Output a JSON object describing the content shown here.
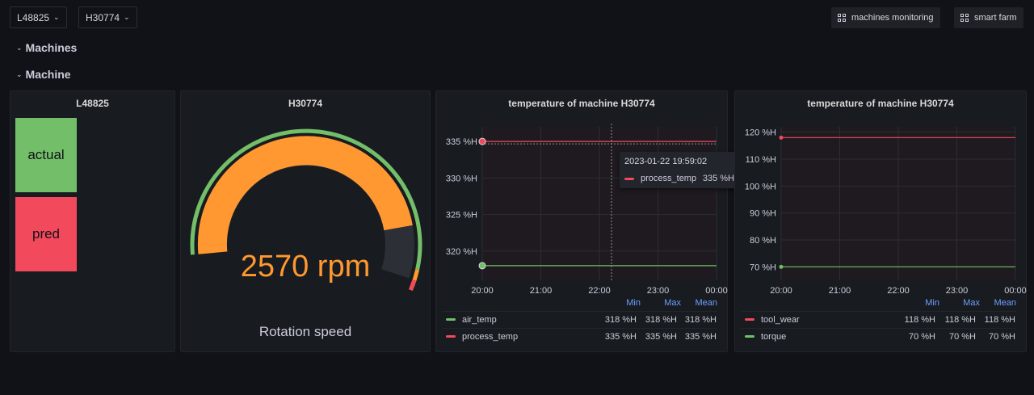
{
  "topbar": {
    "var1_value": "L48825",
    "var2_value": "H30774",
    "links": [
      {
        "label": "machines monitoring",
        "icon": "apps-icon"
      },
      {
        "label": "smart farm",
        "icon": "apps-icon"
      }
    ]
  },
  "rows": [
    {
      "title": "Machines",
      "icon": "chevron-down-icon"
    },
    {
      "title": "Machine",
      "icon": "chevron-down-icon"
    }
  ],
  "panels": {
    "stat": {
      "title": "L48825",
      "boxes": [
        {
          "label": "actual",
          "color": "#73bf69"
        },
        {
          "label": "pred",
          "color": "#f2495c"
        }
      ]
    },
    "gauge": {
      "title": "H30774",
      "value": 2570,
      "value_text": "2570 rpm",
      "label": "Rotation speed",
      "fill_fraction": 0.86,
      "colors": {
        "value": "#ff9830",
        "ok": "#73bf69",
        "warn": "#ff9830",
        "critical": "#f2495c",
        "track": "#2c2f36"
      }
    },
    "chart1": {
      "title": "temperature of machine H30774",
      "tooltip": {
        "time": "2023-01-22 19:59:02",
        "series": "process_temp",
        "value": "335 %H"
      },
      "legend_headers": [
        "Min",
        "Max",
        "Mean"
      ],
      "legend_rows": [
        {
          "name": "air_temp",
          "color": "#73bf69",
          "min": "318 %H",
          "max": "318 %H",
          "mean": "318 %H"
        },
        {
          "name": "process_temp",
          "color": "#f2495c",
          "min": "335 %H",
          "max": "335 %H",
          "mean": "335 %H"
        }
      ]
    },
    "chart2": {
      "title": "temperature of machine H30774",
      "legend_headers": [
        "Min",
        "Max",
        "Mean"
      ],
      "legend_rows": [
        {
          "name": "tool_wear",
          "color": "#f2495c",
          "min": "118 %H",
          "max": "118 %H",
          "mean": "118 %H"
        },
        {
          "name": "torque",
          "color": "#73bf69",
          "min": "70 %H",
          "max": "70 %H",
          "mean": "70 %H"
        }
      ]
    }
  },
  "chart_data": [
    {
      "type": "line",
      "title": "temperature of machine H30774",
      "x_ticks": [
        "20:00",
        "21:00",
        "22:00",
        "23:00",
        "00:00"
      ],
      "y_ticks": [
        "320 %H",
        "325 %H",
        "330 %H",
        "335 %H"
      ],
      "ylim": [
        316,
        337
      ],
      "grid": true,
      "legend": "bottom",
      "series": [
        {
          "name": "air_temp",
          "color": "#73bf69",
          "x": [
            "20:00",
            "00:00"
          ],
          "values": [
            318,
            318
          ]
        },
        {
          "name": "process_temp",
          "color": "#f2495c",
          "x": [
            "20:00",
            "00:00"
          ],
          "values": [
            335,
            335
          ]
        }
      ]
    },
    {
      "type": "line",
      "title": "temperature of machine H30774",
      "x_ticks": [
        "20:00",
        "21:00",
        "22:00",
        "23:00",
        "00:00"
      ],
      "y_ticks": [
        "70 %H",
        "80 %H",
        "90 %H",
        "100 %H",
        "110 %H",
        "120 %H"
      ],
      "ylim": [
        65,
        122
      ],
      "grid": true,
      "legend": "bottom",
      "series": [
        {
          "name": "tool_wear",
          "color": "#f2495c",
          "x": [
            "20:00",
            "00:00"
          ],
          "values": [
            118,
            118
          ]
        },
        {
          "name": "torque",
          "color": "#73bf69",
          "x": [
            "20:00",
            "00:00"
          ],
          "values": [
            70,
            70
          ]
        }
      ]
    }
  ]
}
